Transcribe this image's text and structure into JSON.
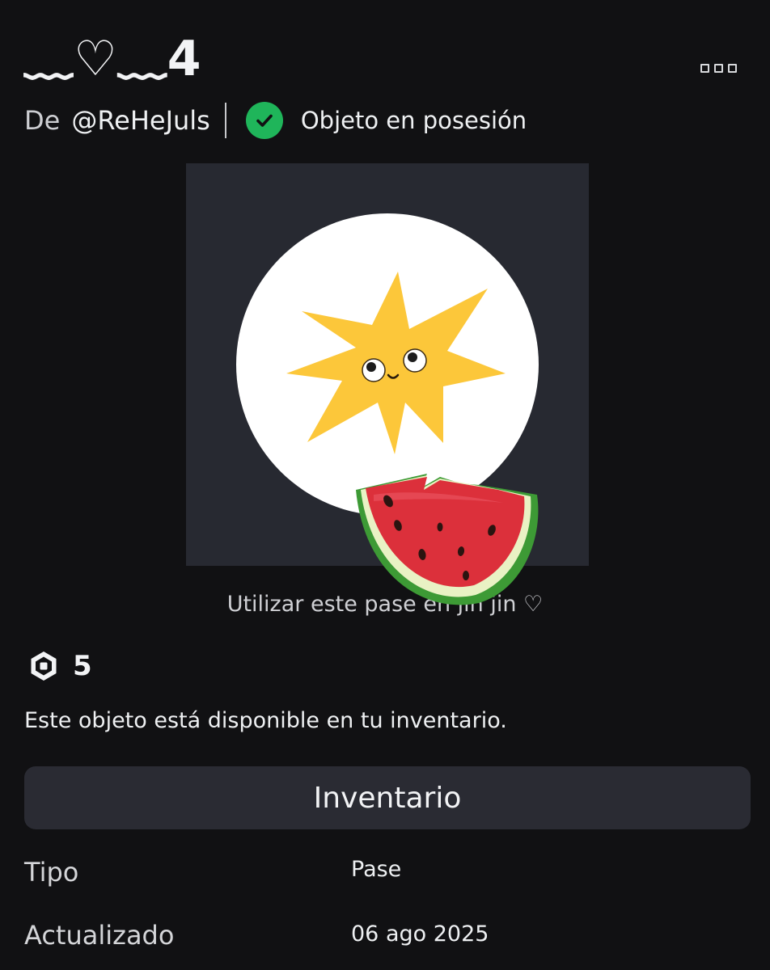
{
  "item": {
    "title": "﹏♡﹏4",
    "by_label": "De",
    "creator": "@ReHeJuls",
    "owned_status": "Objeto en posesión",
    "description": "Utilizar este pase en jin jin ♡"
  },
  "price": {
    "icon": "robux-icon",
    "value": "5"
  },
  "availability": "Este objeto está disponible en tu inventario.",
  "inventory_button": "Inventario",
  "details": [
    {
      "label": "Tipo",
      "value": "Pase"
    },
    {
      "label": "Actualizado",
      "value": "06 ago 2025"
    }
  ],
  "colors": {
    "background": "#111113",
    "check_green": "#1fb55a",
    "button_bg": "#2a2b33",
    "thumb_bg": "#272931",
    "star_yellow": "#fcc73a"
  }
}
